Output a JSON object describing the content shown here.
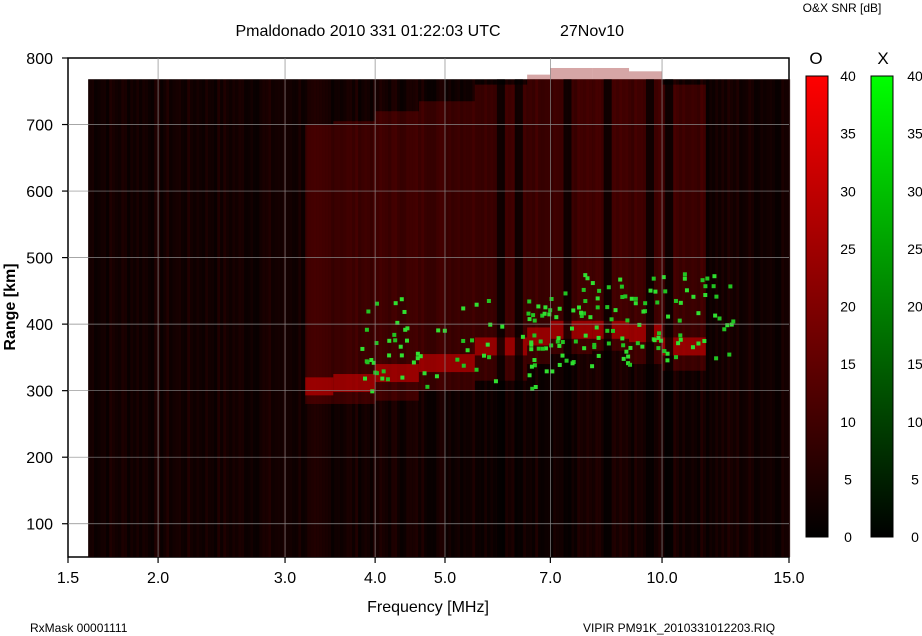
{
  "header": {
    "title": "Pmaldonado 2010 331 01:22:03 UTC",
    "date": "27Nov10",
    "colorbar_caption": "O&X SNR [dB]"
  },
  "footer": {
    "rx_mask": "RxMask 00001111",
    "file_name": "VIPIR  PM91K_2010331012203.RIQ"
  },
  "chart_data": {
    "type": "heatmap",
    "title": "Pmaldonado 2010 331 01:22:03 UTC",
    "xlabel": "Frequency [MHz]",
    "ylabel": "Range [km]",
    "x_scale": "log",
    "xlim": [
      1.5,
      15.0
    ],
    "ylim": [
      50,
      800
    ],
    "x_ticks": [
      1.5,
      2.0,
      3.0,
      4.0,
      5.0,
      7.0,
      10.0,
      15.0
    ],
    "x_tick_labels": [
      "1.5",
      "2.0",
      "3.0",
      "4.0",
      "5.0",
      "7.0",
      "10.0",
      "15.0"
    ],
    "y_ticks": [
      100,
      200,
      300,
      400,
      500,
      600,
      700,
      800
    ],
    "y_tick_labels": [
      "100",
      "200",
      "300",
      "400",
      "500",
      "600",
      "700",
      "800"
    ],
    "grid": true,
    "data_extent": {
      "freq_mhz": [
        1.6,
        15.0
      ],
      "range_km": [
        50,
        768
      ]
    },
    "colorbars": [
      {
        "name": "O",
        "color": "#ff0000",
        "range": [
          0,
          40
        ],
        "ticks": [
          0,
          5,
          10,
          15,
          20,
          25,
          30,
          35,
          40
        ]
      },
      {
        "name": "X",
        "color": "#00ff00",
        "range": [
          0,
          40
        ],
        "ticks": [
          0,
          5,
          10,
          15,
          20,
          25,
          30,
          35,
          40
        ]
      }
    ],
    "o_mode_trace": [
      {
        "freq": 3.2,
        "range": 300
      },
      {
        "freq": 3.5,
        "range": 300
      },
      {
        "freq": 4.0,
        "range": 305
      },
      {
        "freq": 4.6,
        "range": 320
      },
      {
        "freq": 5.5,
        "range": 335
      },
      {
        "freq": 6.5,
        "range": 360
      },
      {
        "freq": 7.0,
        "range": 375
      },
      {
        "freq": 8.0,
        "range": 385
      },
      {
        "freq": 9.0,
        "range": 380
      },
      {
        "freq": 10.0,
        "range": 360
      },
      {
        "freq": 11.5,
        "range": 350
      }
    ],
    "x_mode_trace": [
      {
        "freq": 3.8,
        "range": 360
      },
      {
        "freq": 4.4,
        "range": 380
      },
      {
        "freq": 6.5,
        "range": 370
      },
      {
        "freq": 7.0,
        "range": 400
      },
      {
        "freq": 8.0,
        "range": 410
      },
      {
        "freq": 9.0,
        "range": 400
      },
      {
        "freq": 10.5,
        "range": 420
      },
      {
        "freq": 12.5,
        "range": 410
      }
    ]
  }
}
